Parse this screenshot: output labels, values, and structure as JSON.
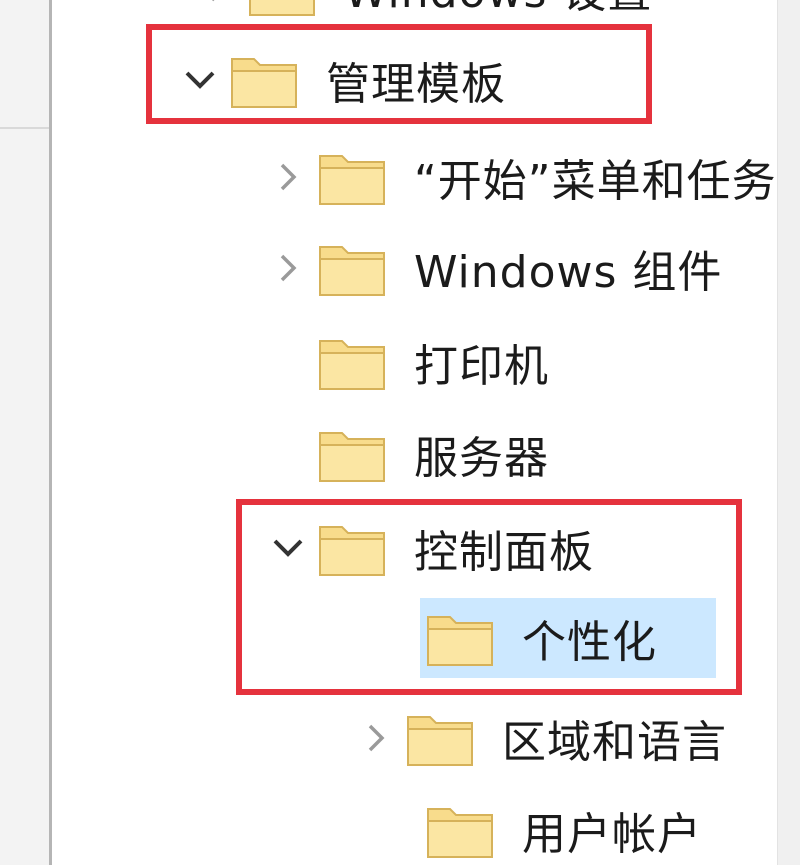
{
  "tree": {
    "items": [
      {
        "label": "Windows 设置",
        "expander": "chevron-right"
      },
      {
        "label": "管理模板",
        "expander": "chevron-down"
      },
      {
        "label": "“开始”菜单和任务栏",
        "expander": "chevron-right"
      },
      {
        "label": "Windows 组件",
        "expander": "chevron-right"
      },
      {
        "label": "打印机",
        "expander": "none"
      },
      {
        "label": "服务器",
        "expander": "none"
      },
      {
        "label": "控制面板",
        "expander": "chevron-down"
      },
      {
        "label": "个性化",
        "expander": "none",
        "selected": true
      },
      {
        "label": "区域和语言",
        "expander": "chevron-right"
      },
      {
        "label": "用户帐户",
        "expander": "none"
      }
    ]
  },
  "colors": {
    "highlight_box": "#e5323d",
    "selection": "#cce8ff",
    "folder_fill": "#f8dc8c",
    "folder_stroke": "#d6b25a"
  }
}
